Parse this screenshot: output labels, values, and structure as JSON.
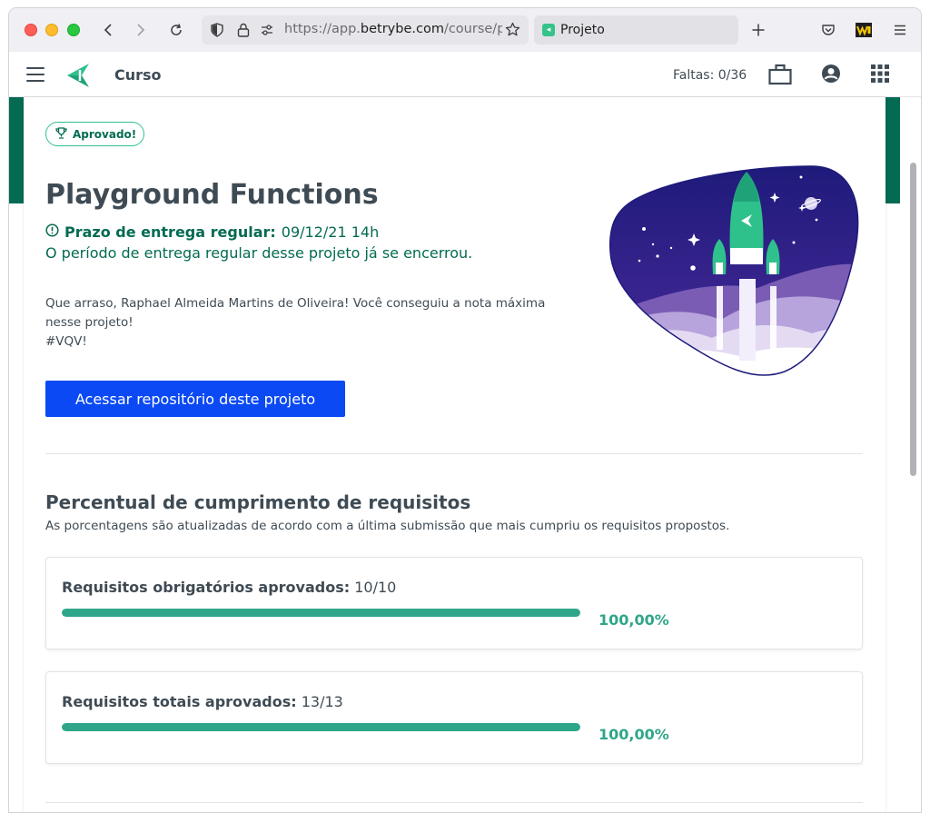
{
  "browser": {
    "url_prefix": "https://app.",
    "url_domain": "betrybe.com",
    "url_suffix": "/course/p",
    "tab_title": "Projeto"
  },
  "header": {
    "title": "Curso",
    "faltas": "Faltas: 0/36"
  },
  "project": {
    "badge": "Aprovado!",
    "title": "Playground Functions",
    "deadline_label": "Prazo de entrega regular:",
    "deadline_value": "09/12/21 14h",
    "deadline_closed": "O período de entrega regular desse projeto já se encerrou.",
    "congrats_line1": "Que arraso, Raphael Almeida Martins de Oliveira! Você conseguiu a nota máxima",
    "congrats_line2": "nesse projeto!",
    "congrats_line3": "#VQV!",
    "repo_button": "Acessar repositório deste projeto"
  },
  "requirements": {
    "title": "Percentual de cumprimento de requisitos",
    "subtitle": "As porcentagens são atualizadas de acordo com a última submissão que mais cumpriu os requisitos propostos.",
    "items": [
      {
        "label": "Requisitos obrigatórios aprovados:",
        "count": "10/10",
        "percent_text": "100,00%",
        "progress": 1.0
      },
      {
        "label": "Requisitos totais aprovados:",
        "count": "13/13",
        "percent_text": "100,00%",
        "progress": 1.0
      }
    ]
  },
  "colors": {
    "brand_green": "#036b52",
    "accent_green": "#2fa68a",
    "primary_blue": "#0a49f3"
  },
  "icons": [
    "back-icon",
    "forward-icon",
    "reload-icon",
    "shield-icon",
    "lock-icon",
    "permissions-icon",
    "bookmark-star-icon",
    "new-tab-icon",
    "pocket-icon",
    "extension-icon",
    "menu-icon",
    "hamburger-icon",
    "trybe-logo-icon",
    "briefcase-icon",
    "user-account-icon",
    "apps-grid-icon",
    "trophy-icon",
    "alert-circle-icon",
    "rocket-illustration"
  ]
}
